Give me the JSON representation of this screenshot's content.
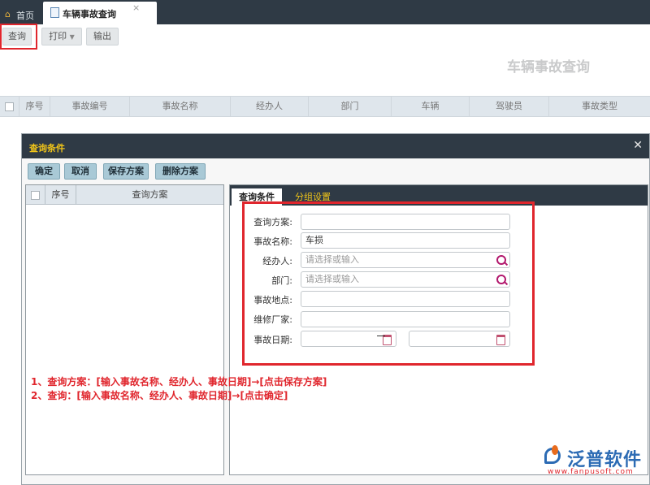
{
  "tabs": {
    "home_label": "首页",
    "active_label": "车辆事故查询",
    "close_glyph": "×"
  },
  "toolbar": {
    "query_label": "查询",
    "print_label": "打印",
    "export_label": "输出"
  },
  "page": {
    "title": "车辆事故查询"
  },
  "grid": {
    "columns": [
      "序号",
      "事故编号",
      "事故名称",
      "经办人",
      "部门",
      "车辆",
      "驾驶员",
      "事故类型"
    ]
  },
  "dialog": {
    "title": "查询条件",
    "close_glyph": "✕",
    "buttons": {
      "ok": "确定",
      "cancel": "取消",
      "save_plan": "保存方案",
      "delete_plan": "删除方案"
    },
    "plan_list": {
      "columns": [
        "序号",
        "查询方案"
      ]
    },
    "tabs": {
      "conditions": "查询条件",
      "grouping": "分组设置"
    },
    "form": {
      "plan_label": "查询方案:",
      "plan_value": "",
      "name_label": "事故名称:",
      "name_value": "车损",
      "handler_label": "经办人:",
      "handler_placeholder": "请选择或输入",
      "dept_label": "部门:",
      "dept_placeholder": "请选择或输入",
      "place_label": "事故地点:",
      "place_value": "",
      "factory_label": "维修厂家:",
      "factory_value": "",
      "date_label": "事故日期:",
      "date_from": "",
      "date_to": ""
    }
  },
  "annotations": {
    "line1": "1、查询方案：[输入事故名称、经办人、事故日期]→[点击保存方案]",
    "line2": "2、查询：[输入事故名称、经办人、事故日期]→[点击确定]"
  },
  "logo": {
    "name": "泛普软件",
    "url": "www.fanpusoft.com"
  },
  "colors": {
    "dark_bar": "#2f3a45",
    "accent_yellow": "#f0c419",
    "highlight_red": "#e0262d",
    "button_blue": "#a9c9d6"
  }
}
